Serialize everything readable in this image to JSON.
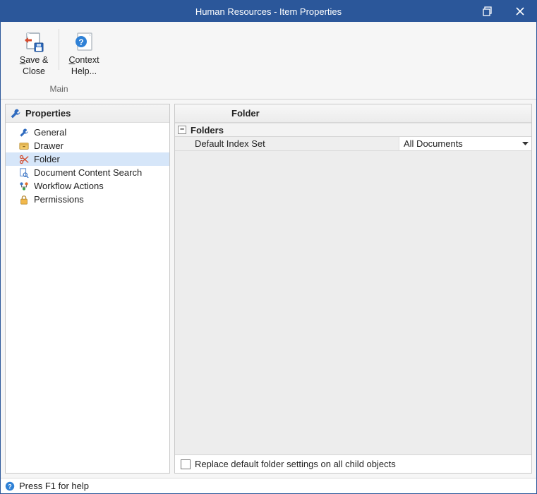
{
  "window": {
    "title": "Human Resources - Item Properties"
  },
  "ribbon": {
    "save_close_l1": "Save &",
    "save_close_l2": "Close",
    "context_help_l1": "Context",
    "context_help_l2": "Help...",
    "group_main": "Main"
  },
  "sidebar": {
    "header": "Properties",
    "items": [
      {
        "label": "General"
      },
      {
        "label": "Drawer"
      },
      {
        "label": "Folder"
      },
      {
        "label": "Document Content Search"
      },
      {
        "label": "Workflow Actions"
      },
      {
        "label": "Permissions"
      }
    ]
  },
  "pane": {
    "title": "Folder",
    "category": "Folders",
    "prop_label": "Default Index Set",
    "prop_value": "All Documents",
    "footer_checkbox_label": "Replace default folder settings on all child objects"
  },
  "statusbar": {
    "text": "Press F1 for help"
  }
}
